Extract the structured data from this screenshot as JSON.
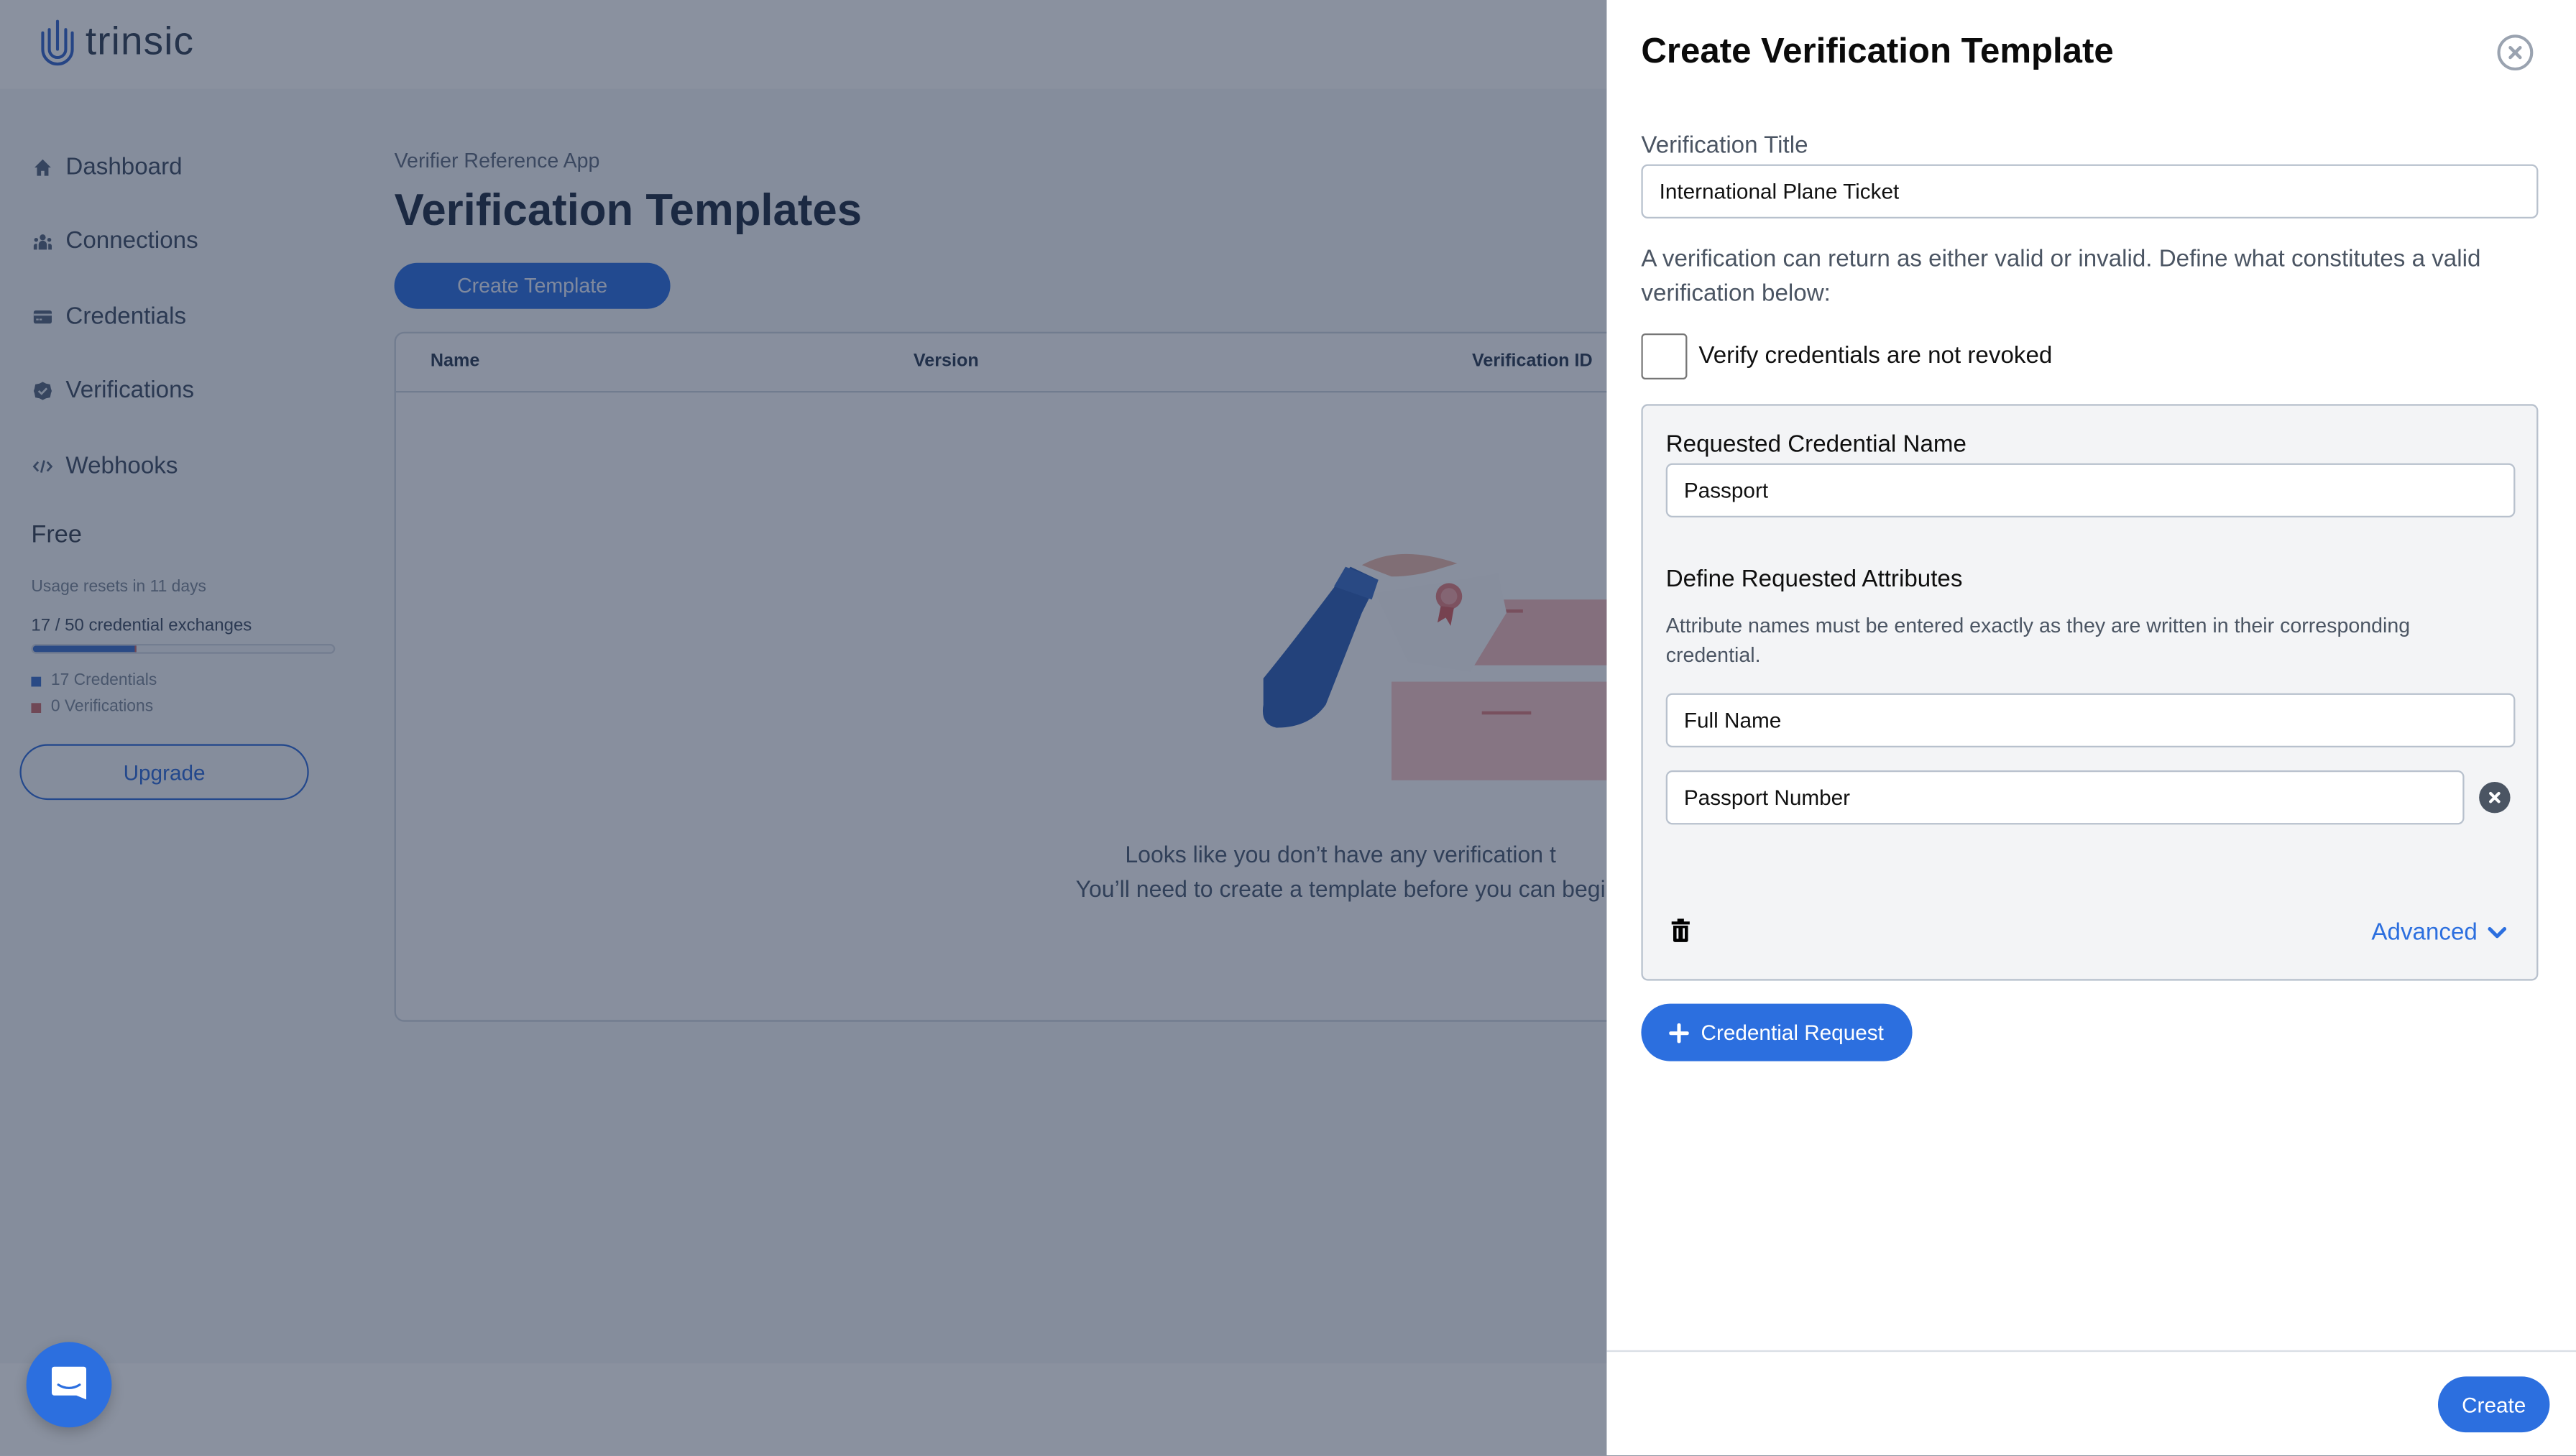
{
  "app": {
    "brand": "trinsic"
  },
  "sidebar": {
    "items": [
      {
        "label": "Dashboard",
        "icon": "home-icon"
      },
      {
        "label": "Connections",
        "icon": "users-icon"
      },
      {
        "label": "Credentials",
        "icon": "credit-card-icon"
      },
      {
        "label": "Verifications",
        "icon": "badge-check-icon"
      },
      {
        "label": "Webhooks",
        "icon": "code-icon"
      }
    ],
    "plan": "Free",
    "usage_reset": "Usage resets in 11 days",
    "usage_count": "17 / 50 credential exchanges",
    "usage_progress": 0.34,
    "legend": [
      {
        "label": "17 Credentials",
        "color": "#3c6fc9"
      },
      {
        "label": "0 Verifications",
        "color": "#c96a6a"
      }
    ],
    "upgrade_label": "Upgrade"
  },
  "main": {
    "breadcrumb": "Verifier Reference App",
    "title": "Verification Templates",
    "create_template_label": "Create Template",
    "table": {
      "columns": [
        "Name",
        "Version",
        "Verification ID"
      ],
      "rows": []
    },
    "empty_state": {
      "line1": "Looks like you don’t have any verification t",
      "line2": "You’ll need to create a template before you can begi"
    }
  },
  "drawer": {
    "title": "Create Verification Template",
    "verification_title_label": "Verification Title",
    "verification_title_value": "International Plane Ticket",
    "help_text": "A verification can return as either valid or invalid. Define what constitutes a valid verification below:",
    "revocation_checkbox_label": "Verify credentials are not revoked",
    "revocation_checked": false,
    "credential_request": {
      "name_label": "Requested Credential Name",
      "name_value": "Passport",
      "attributes_heading": "Define Requested Attributes",
      "attributes_help": "Attribute names must be entered exactly as they are written in their corresponding credential.",
      "attributes": [
        "Full Name",
        "Passport Number"
      ],
      "advanced_label": "Advanced"
    },
    "add_credential_request_label": "Credential Request",
    "create_label": "Create"
  },
  "colors": {
    "accent": "#2c6fdf",
    "scrim": "#87909f"
  }
}
